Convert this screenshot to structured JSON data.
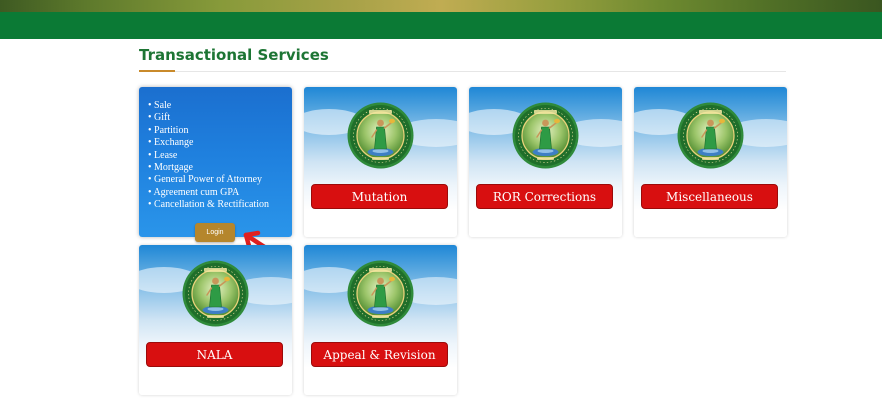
{
  "section": {
    "title": "Transactional Services"
  },
  "first_card": {
    "services": [
      "Sale",
      "Gift",
      "Partition",
      "Exchange",
      "Lease",
      "Mortgage",
      "General Power of Attorney",
      "Agreement cum GPA",
      "Cancellation & Rectification"
    ],
    "login_label": "Login"
  },
  "cards": [
    {
      "label": "Mutation"
    },
    {
      "label": "ROR Corrections"
    },
    {
      "label": "Miscellaneous"
    },
    {
      "label": "NALA"
    },
    {
      "label": "Appeal & Revision"
    }
  ],
  "seal": {
    "icon": "dharani-seal-icon"
  },
  "colors": {
    "header_green": "#0b7a35",
    "title_green": "#1d7534",
    "card_button_red": "#d80f10",
    "login_gold": "#b5862c",
    "arrow_red": "#e02020"
  }
}
